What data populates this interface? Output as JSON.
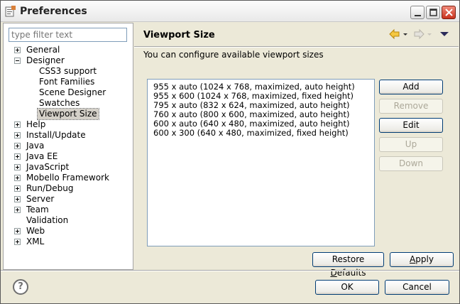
{
  "window": {
    "title": "Preferences",
    "icon": "eclipse-preferences-icon"
  },
  "filter": {
    "placeholder": "type filter text",
    "value": ""
  },
  "tree": [
    {
      "label": "General",
      "expander": "plus",
      "indent": 0
    },
    {
      "label": "Designer",
      "expander": "minus",
      "indent": 0
    },
    {
      "label": "CSS3 support",
      "expander": "none",
      "indent": 1
    },
    {
      "label": "Font Families",
      "expander": "none",
      "indent": 1
    },
    {
      "label": "Scene Designer",
      "expander": "none",
      "indent": 1
    },
    {
      "label": "Swatches",
      "expander": "none",
      "indent": 1
    },
    {
      "label": "Viewport Size",
      "expander": "none",
      "indent": 1,
      "selected": true
    },
    {
      "label": "Help",
      "expander": "plus",
      "indent": 0
    },
    {
      "label": "Install/Update",
      "expander": "plus",
      "indent": 0
    },
    {
      "label": "Java",
      "expander": "plus",
      "indent": 0
    },
    {
      "label": "Java EE",
      "expander": "plus",
      "indent": 0
    },
    {
      "label": "JavaScript",
      "expander": "plus",
      "indent": 0
    },
    {
      "label": "Mobello Framework",
      "expander": "plus",
      "indent": 0
    },
    {
      "label": "Run/Debug",
      "expander": "plus",
      "indent": 0
    },
    {
      "label": "Server",
      "expander": "plus",
      "indent": 0
    },
    {
      "label": "Team",
      "expander": "plus",
      "indent": 0
    },
    {
      "label": "Validation",
      "expander": "none",
      "indent": 0
    },
    {
      "label": "Web",
      "expander": "plus",
      "indent": 0
    },
    {
      "label": "XML",
      "expander": "plus",
      "indent": 0
    }
  ],
  "page": {
    "title": "Viewport Size",
    "description": "You can configure available viewport sizes",
    "viewports": [
      "955 x auto (1024 x 768, maximized, auto height)",
      "955 x 600 (1024 x 768, maximized, fixed height)",
      "795 x auto (832 x 624, maximized, auto height)",
      "760 x auto (800 x 600, maximized, auto height)",
      "600 x auto (640 x 480, maximized, auto height)",
      "600 x 300 (640 x 480, maximized, fixed height)"
    ],
    "buttons": {
      "add": "Add",
      "remove": "Remove",
      "edit": "Edit",
      "up": "Up",
      "down": "Down"
    },
    "restore_defaults_pre": "Restore ",
    "restore_defaults_mnemonic": "D",
    "restore_defaults_post": "efaults",
    "apply_mnemonic": "A",
    "apply_post": "pply"
  },
  "footer": {
    "help": "?",
    "ok": "OK",
    "cancel": "Cancel"
  }
}
